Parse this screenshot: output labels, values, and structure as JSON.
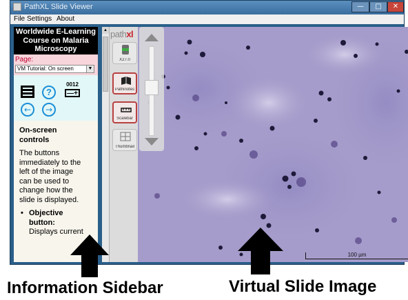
{
  "window": {
    "title": "PathXL Slide Viewer",
    "minimize_glyph": "—",
    "maximize_glyph": "□",
    "close_glyph": "✕"
  },
  "menu": {
    "items": [
      "File",
      "Settings",
      "About"
    ]
  },
  "sidebar": {
    "course_title": "Worldwide E-Learning Course on Malaria Microscopy",
    "page_label": "Page:",
    "page_select_value": "VM Tutorial: On screen",
    "icons": [
      "menu-icon",
      "help-icon",
      "counter-icon",
      "back-arrow-icon",
      "forward-arrow-icon"
    ],
    "help_glyph": "?",
    "counter_value": "0012",
    "counter_glyph": "—+",
    "back_glyph": "←",
    "forward_glyph": "→",
    "section_title": "On-screen controls",
    "body_text": "The buttons immediately to the left of the image can be used to change how the slide is displayed.",
    "bullet_head": "Objective button:",
    "bullet_text": "Displays current"
  },
  "toolbar": {
    "logo_prefix": "path",
    "logo_suffix": "xl",
    "buttons": [
      {
        "label": "X27.0",
        "icon": "objective-icon"
      },
      {
        "label": "Pathinotes",
        "icon": "book-icon"
      },
      {
        "label": "Scalebar",
        "icon": "ruler-icon"
      },
      {
        "label": "Thumbnail",
        "icon": "grid-icon"
      }
    ]
  },
  "slide": {
    "scale_label": "100 µm",
    "zoom_level": 0.45
  },
  "annotations": {
    "left_caption": "Information Sidebar",
    "right_caption": "Virtual Slide Image"
  }
}
